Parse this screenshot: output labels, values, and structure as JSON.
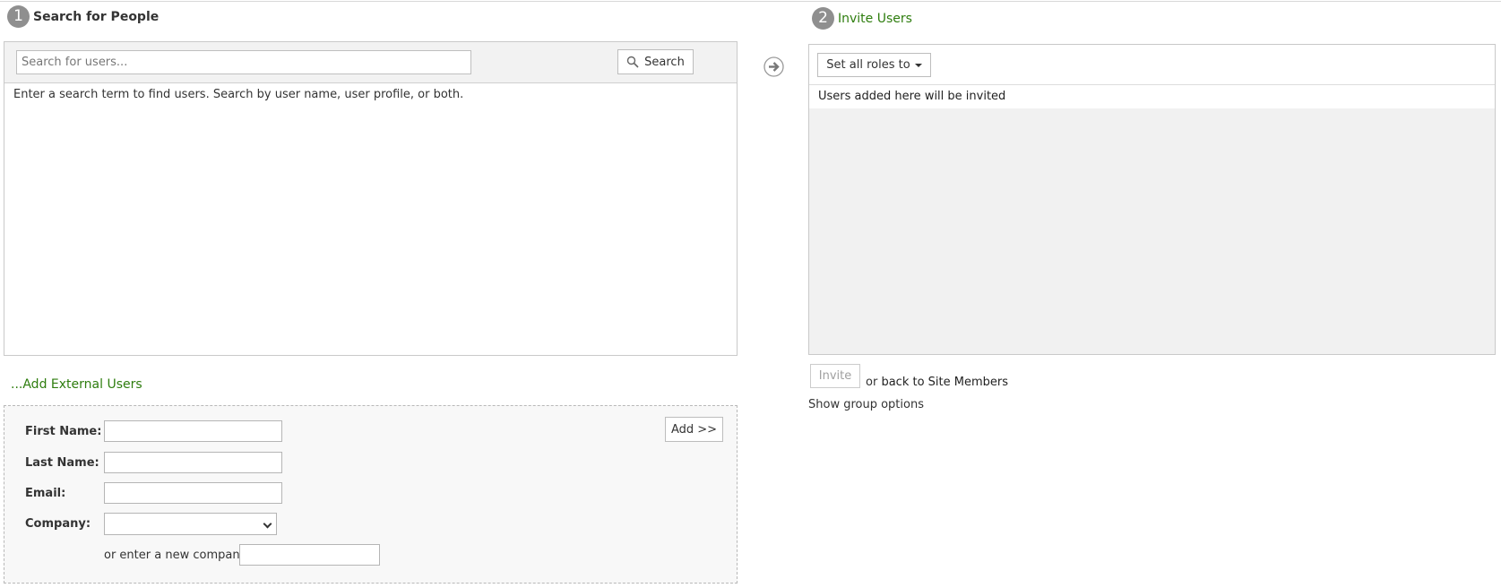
{
  "step1": {
    "number": "1",
    "title": "Search for People"
  },
  "step2": {
    "number": "2",
    "title": "Invite Users"
  },
  "search": {
    "placeholder": "Search for users...",
    "button_label": "Search",
    "hint": "Enter a search term to find users. Search by user name, user profile, or both."
  },
  "invite": {
    "set_roles_label": "Set all roles to",
    "empty_message": "Users added here will be invited",
    "invite_button_label": "Invite",
    "or_text": "or",
    "back_link_text": "back to Site Members",
    "show_group_options": "Show group options"
  },
  "external": {
    "title": "...Add External Users",
    "first_name_label": "First Name:",
    "last_name_label": "Last Name:",
    "email_label": "Email:",
    "company_label": "Company:",
    "new_company_label": "or enter a new company",
    "add_button_label": "Add >>"
  },
  "icons": {
    "search": "magnifier-icon",
    "step_arrow": "arrow-right-circle-icon",
    "dropdown": "caret-down-icon"
  },
  "colors": {
    "accent_green": "#2e7d0e",
    "step_badge": "#8f8f8f",
    "panel_gray": "#f1f1f1"
  }
}
